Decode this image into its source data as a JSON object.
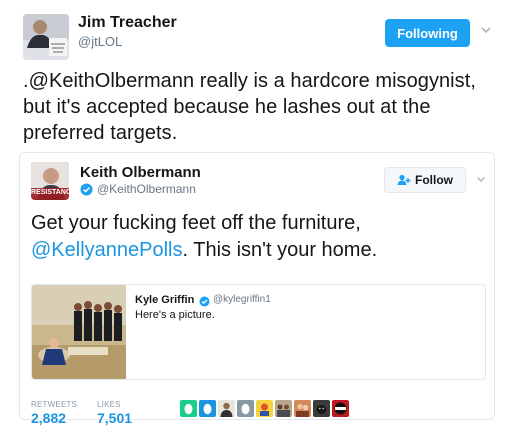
{
  "outer_tweet": {
    "display_name": "Jim Treacher",
    "handle": "@jtLOL",
    "follow_button": "Following",
    "text": ".@KeithOlbermann really is a hardcore misogynist, but it's accepted because he lashes out at the preferred targets.",
    "avatar": "person-portrait-icon"
  },
  "quoted_tweet": {
    "display_name": "Keith Olbermann",
    "handle": "@KeithOlbermann",
    "verified": true,
    "avatar_caption": "RESISTANCE",
    "follow_button": "Follow",
    "text_before": "Get your fucking feet off the furniture, ",
    "mention": "@KellyannePolls",
    "text_after": ". This isn't your home.",
    "nested": {
      "display_name": "Kyle Griffin",
      "handle": "@kylegriffin1",
      "verified": true,
      "text": "Here's a picture."
    },
    "stats": {
      "retweets_label": "RETWEETS",
      "retweets_value": "2,882",
      "likes_label": "LIKES",
      "likes_value": "7,501"
    },
    "liker_avatars": [
      "green-egg",
      "blue-egg",
      "person",
      "gray-egg",
      "cartoon",
      "group",
      "people",
      "dog",
      "tolls-logo"
    ]
  },
  "colors": {
    "accent_blue": "#1da1f2",
    "link_blue": "#1b95e0",
    "verified_blue": "#1da1f2",
    "border": "#e1e8ed",
    "muted": "#657786"
  }
}
